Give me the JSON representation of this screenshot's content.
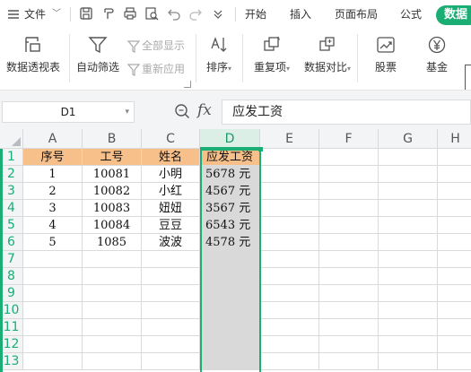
{
  "menubar": {
    "file_label": "文件",
    "tabs": [
      "开始",
      "插入",
      "页面布局",
      "公式",
      "数据"
    ],
    "active_tab": "数据",
    "accent_color": "#1aad74"
  },
  "ribbon": {
    "pivot_label": "数据透视表",
    "autofilter_label": "自动筛选",
    "show_all_label": "全部显示",
    "reapply_label": "重新应用",
    "sort_label": "排序",
    "duplicates_label": "重复项",
    "compare_label": "数据对比",
    "stock_label": "股票",
    "fund_label": "基金"
  },
  "formula_bar": {
    "name_box": "D1",
    "fx_label": "fx",
    "content": "应发工资"
  },
  "sheet": {
    "columns": [
      "A",
      "B",
      "C",
      "D",
      "E",
      "F",
      "G",
      "H"
    ],
    "rows": [
      "1",
      "2",
      "3",
      "4",
      "5",
      "6",
      "7",
      "8",
      "9",
      "10",
      "11",
      "12",
      "13"
    ],
    "selected_column": "D",
    "header_fill": "#f7c08a",
    "selection_fill": "#d9d9d9",
    "table": {
      "headers": [
        "序号",
        "工号",
        "姓名",
        "应发工资"
      ],
      "data": [
        [
          "1",
          "10081",
          "小明",
          "5678 元"
        ],
        [
          "2",
          "10082",
          "小红",
          "4567 元"
        ],
        [
          "3",
          "10083",
          "妞妞",
          "3567 元"
        ],
        [
          "4",
          "10084",
          "豆豆",
          "6543 元"
        ],
        [
          "5",
          "1085",
          "波波",
          "4578 元"
        ]
      ]
    }
  }
}
